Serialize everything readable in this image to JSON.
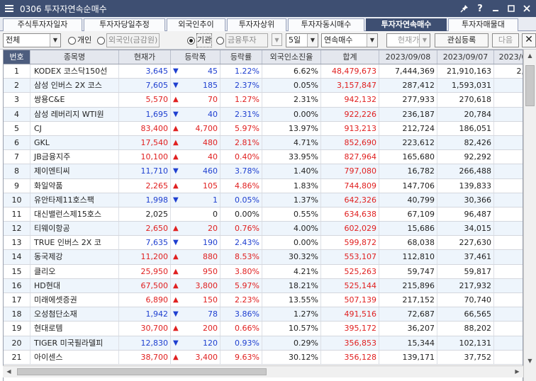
{
  "window": {
    "title": "0306 투자자연속순매수"
  },
  "tabs": [
    {
      "label": "주식투자자일자"
    },
    {
      "label": "투자자당일추정"
    },
    {
      "label": "외국인추이"
    },
    {
      "label": "투자자상위"
    },
    {
      "label": "투자자동시매수"
    },
    {
      "label": "투자자연속매수"
    },
    {
      "label": "투자자매물대"
    }
  ],
  "toolbar": {
    "market": "전체",
    "radio_individual": "개인",
    "radio_foreign": "외국인(금감원)",
    "radio_institution": "기관",
    "institution_sub": "금융투자",
    "period": "5일",
    "mode": "연속매수",
    "price_type": "현재가",
    "watch_button": "관심등록",
    "next_button": "다음",
    "close_symbol": "✕"
  },
  "columns": [
    "번호",
    "종목명",
    "현재가",
    "등락폭",
    "등락률",
    "외국인소진율",
    "합계",
    "2023/09/08",
    "2023/09/07",
    "2023/09"
  ],
  "rows": [
    {
      "no": "1",
      "name": "KODEX 코스닥150선",
      "price": "3,645",
      "dir": "dn",
      "chg": "45",
      "rate": "1.22%",
      "foreign": "6.62%",
      "sum": "48,479,673",
      "d1": "7,444,369",
      "d2": "21,910,163",
      "d3": "2,32"
    },
    {
      "no": "2",
      "name": "삼성 인버스 2X 코스",
      "price": "7,605",
      "dir": "dn",
      "chg": "185",
      "rate": "2.37%",
      "foreign": "0.05%",
      "sum": "3,157,847",
      "d1": "287,412",
      "d2": "1,593,031",
      "d3": "1"
    },
    {
      "no": "3",
      "name": "쌍용C&E",
      "price": "5,570",
      "dir": "up",
      "chg": "70",
      "rate": "1.27%",
      "foreign": "2.31%",
      "sum": "942,132",
      "d1": "277,933",
      "d2": "270,618",
      "d3": "8"
    },
    {
      "no": "4",
      "name": "삼성 레버리지 WTI원",
      "price": "1,695",
      "dir": "dn",
      "chg": "40",
      "rate": "2.31%",
      "foreign": "0.00%",
      "sum": "922,226",
      "d1": "236,187",
      "d2": "20,784",
      "d3": "25"
    },
    {
      "no": "5",
      "name": "CJ",
      "price": "83,400",
      "dir": "up",
      "chg": "4,700",
      "rate": "5.97%",
      "foreign": "13.97%",
      "sum": "913,213",
      "d1": "212,724",
      "d2": "186,051",
      "d3": "20"
    },
    {
      "no": "6",
      "name": "GKL",
      "price": "17,540",
      "dir": "up",
      "chg": "480",
      "rate": "2.81%",
      "foreign": "4.71%",
      "sum": "852,690",
      "d1": "223,612",
      "d2": "82,426",
      "d3": "20"
    },
    {
      "no": "7",
      "name": "JB금융지주",
      "price": "10,100",
      "dir": "up",
      "chg": "40",
      "rate": "0.40%",
      "foreign": "33.95%",
      "sum": "827,964",
      "d1": "165,680",
      "d2": "92,292",
      "d3": "30"
    },
    {
      "no": "8",
      "name": "제이엔티씨",
      "price": "11,710",
      "dir": "dn",
      "chg": "460",
      "rate": "3.78%",
      "foreign": "1.40%",
      "sum": "797,080",
      "d1": "16,782",
      "d2": "266,488",
      "d3": "29"
    },
    {
      "no": "9",
      "name": "화일약품",
      "price": "2,265",
      "dir": "up",
      "chg": "105",
      "rate": "4.86%",
      "foreign": "1.83%",
      "sum": "744,809",
      "d1": "147,706",
      "d2": "139,833",
      "d3": "15"
    },
    {
      "no": "10",
      "name": "유안타제11호스팩",
      "price": "1,998",
      "dir": "dn",
      "chg": "1",
      "rate": "0.05%",
      "foreign": "1.37%",
      "sum": "642,326",
      "d1": "40,799",
      "d2": "30,366",
      "d3": "4"
    },
    {
      "no": "11",
      "name": "대신밸런스제15호스",
      "price": "2,025",
      "dir": "flat",
      "chg": "0",
      "rate": "0.00%",
      "foreign": "0.55%",
      "sum": "634,638",
      "d1": "67,109",
      "d2": "96,487",
      "d3": "1"
    },
    {
      "no": "12",
      "name": "티웨이항공",
      "price": "2,650",
      "dir": "up",
      "chg": "20",
      "rate": "0.76%",
      "foreign": "4.00%",
      "sum": "602,029",
      "d1": "15,686",
      "d2": "34,015",
      "d3": "20"
    },
    {
      "no": "13",
      "name": "TRUE 인버스 2X 코",
      "price": "7,635",
      "dir": "dn",
      "chg": "190",
      "rate": "2.43%",
      "foreign": "0.00%",
      "sum": "599,872",
      "d1": "68,038",
      "d2": "227,630",
      "d3": "2"
    },
    {
      "no": "14",
      "name": "동국제강",
      "price": "11,200",
      "dir": "up",
      "chg": "880",
      "rate": "8.53%",
      "foreign": "30.32%",
      "sum": "553,107",
      "d1": "112,810",
      "d2": "37,461",
      "d3": "9"
    },
    {
      "no": "15",
      "name": "클리오",
      "price": "25,950",
      "dir": "up",
      "chg": "950",
      "rate": "3.80%",
      "foreign": "4.21%",
      "sum": "525,263",
      "d1": "59,747",
      "d2": "59,817",
      "d3": "5"
    },
    {
      "no": "16",
      "name": "HD현대",
      "price": "67,500",
      "dir": "up",
      "chg": "3,800",
      "rate": "5.97%",
      "foreign": "18.21%",
      "sum": "525,144",
      "d1": "215,896",
      "d2": "217,932",
      "d3": "3"
    },
    {
      "no": "17",
      "name": "미래에셋증권",
      "price": "6,890",
      "dir": "up",
      "chg": "150",
      "rate": "2.23%",
      "foreign": "13.55%",
      "sum": "507,139",
      "d1": "217,152",
      "d2": "70,740",
      "d3": "8"
    },
    {
      "no": "18",
      "name": "오성첨단소재",
      "price": "1,942",
      "dir": "dn",
      "chg": "78",
      "rate": "3.86%",
      "foreign": "1.27%",
      "sum": "491,516",
      "d1": "72,687",
      "d2": "66,565",
      "d3": "9"
    },
    {
      "no": "19",
      "name": "현대로템",
      "price": "30,700",
      "dir": "up",
      "chg": "200",
      "rate": "0.66%",
      "foreign": "10.57%",
      "sum": "395,172",
      "d1": "36,207",
      "d2": "88,202",
      "d3": "17"
    },
    {
      "no": "20",
      "name": "TIGER 미국필라델피",
      "price": "12,830",
      "dir": "dn",
      "chg": "120",
      "rate": "0.93%",
      "foreign": "0.29%",
      "sum": "356,853",
      "d1": "15,344",
      "d2": "102,131",
      "d3": "10"
    },
    {
      "no": "21",
      "name": "아이센스",
      "price": "38,700",
      "dir": "up",
      "chg": "3,400",
      "rate": "9.63%",
      "foreign": "30.12%",
      "sum": "356,128",
      "d1": "139,171",
      "d2": "37,752",
      "d3": "1"
    }
  ],
  "colors": {
    "title_bar": "#3e4f72",
    "up": "#e02020",
    "down": "#1e3fd0",
    "alt_row": "#eef5fc"
  },
  "icons": {
    "window": "hamburger-icon",
    "pin": "pin-icon",
    "help": "question-icon",
    "minimize": "minimize-icon",
    "maximize": "maximize-icon",
    "close": "close-icon"
  }
}
